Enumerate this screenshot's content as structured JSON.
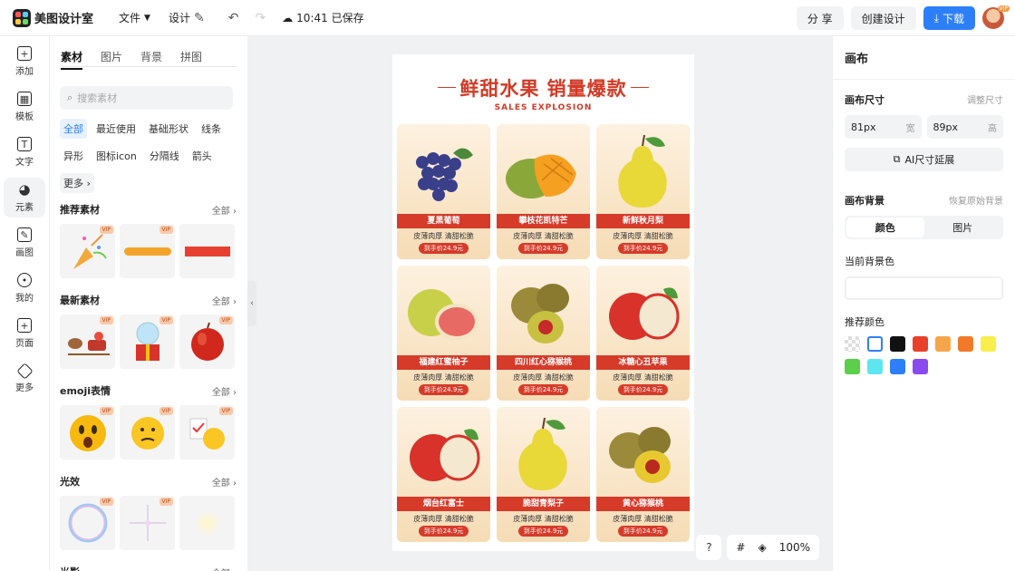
{
  "topbar": {
    "app_name": "美图设计室",
    "file_menu": "文件",
    "design_menu": "设计",
    "saved_status": "10:41 已保存",
    "share": "分 享",
    "create_design": "创建设计",
    "download": "下载",
    "vip_badge": "VIP"
  },
  "rail": [
    {
      "label": "添加",
      "icon": "plus-icon"
    },
    {
      "label": "模板",
      "icon": "template-icon"
    },
    {
      "label": "文字",
      "icon": "text-icon"
    },
    {
      "label": "元素",
      "icon": "shapes-icon"
    },
    {
      "label": "画图",
      "icon": "draw-icon"
    },
    {
      "label": "我的",
      "icon": "user-icon"
    },
    {
      "label": "页面",
      "icon": "page-icon"
    },
    {
      "label": "更多",
      "icon": "cube-icon"
    }
  ],
  "panel": {
    "tabs": [
      "素材",
      "图片",
      "背景",
      "拼图"
    ],
    "search_placeholder": "搜索素材",
    "chips": [
      "全部",
      "最近使用",
      "基础形状",
      "线条",
      "异形",
      "图标icon",
      "分隔线",
      "箭头",
      "更多"
    ],
    "all_label": "全部",
    "vip": "VIP",
    "sections": [
      {
        "title": "推荐素材"
      },
      {
        "title": "最新素材"
      },
      {
        "title": "emoji表情"
      },
      {
        "title": "光效"
      },
      {
        "title": "光影"
      }
    ]
  },
  "poster": {
    "title": "鲜甜水果 销量爆款",
    "subtitle": "SALES EXPLOSION",
    "cards": [
      {
        "name": "夏黑葡萄",
        "desc": "皮薄肉厚 清甜松脆",
        "price": "到手价24.9元",
        "fruit": "grape"
      },
      {
        "name": "攀枝花凯特芒",
        "desc": "皮薄肉厚 清甜松脆",
        "price": "到手价24.9元",
        "fruit": "mango"
      },
      {
        "name": "新鲜秋月梨",
        "desc": "皮薄肉厚 清甜松脆",
        "price": "到手价24.9元",
        "fruit": "pear"
      },
      {
        "name": "福建红蜜柚子",
        "desc": "皮薄肉厚 清甜松脆",
        "price": "到手价24.9元",
        "fruit": "pomelo"
      },
      {
        "name": "四川红心猕猴桃",
        "desc": "皮薄肉厚 清甜松脆",
        "price": "到手价24.9元",
        "fruit": "kiwi-red"
      },
      {
        "name": "冰糖心丑苹果",
        "desc": "皮薄肉厚 清甜松脆",
        "price": "到手价24.9元",
        "fruit": "apple"
      },
      {
        "name": "烟台红富士",
        "desc": "皮薄肉厚 清甜松脆",
        "price": "到手价24.9元",
        "fruit": "apple"
      },
      {
        "name": "脆甜青梨子",
        "desc": "皮薄肉厚 清甜松脆",
        "price": "到手价24.9元",
        "fruit": "pear"
      },
      {
        "name": "黄心猕猴桃",
        "desc": "皮薄肉厚 清甜松脆",
        "price": "到手价24.9元",
        "fruit": "kiwi-gold"
      }
    ]
  },
  "zoom": {
    "help": "?",
    "level": "100%"
  },
  "rpanel": {
    "title": "画布",
    "size_label": "画布尺寸",
    "adjust_size": "调整尺寸",
    "width_value": "81px",
    "width_unit": "宽",
    "height_value": "89px",
    "height_unit": "高",
    "ai_extend": "AI尺寸延展",
    "bg_label": "画布背景",
    "restore_bg": "恢复原始背景",
    "seg_color": "颜色",
    "seg_image": "图片",
    "current_bg": "当前背景色",
    "recommended": "推荐颜色",
    "swatches": [
      "transparent",
      "#ffffff",
      "#111111",
      "#e8402a",
      "#f5a64a",
      "#f07a2a",
      "#f9ef4a",
      "#5ccf4a",
      "#5ee6ee",
      "#2d7ff9",
      "#8b4af0"
    ]
  }
}
